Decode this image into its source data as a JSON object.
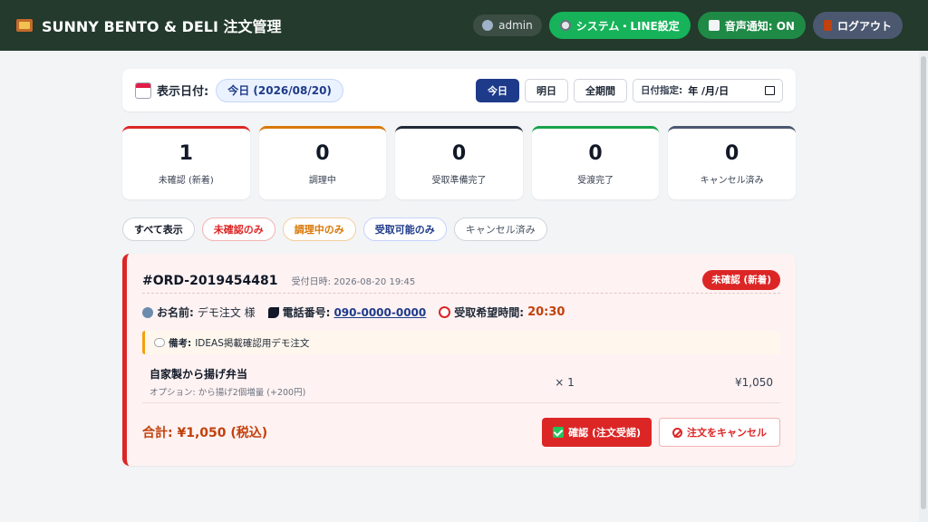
{
  "header": {
    "title": "SUNNY BENTO & DELI 注文管理",
    "user": "admin",
    "settings_label": "システム・LINE設定",
    "sound_label": "音声通知: ON",
    "logout_label": "ログアウト"
  },
  "date_bar": {
    "label": "表示日付:",
    "current": "今日 (2026/08/20)",
    "btn_today": "今日",
    "btn_tomorrow": "明日",
    "btn_all": "全期間",
    "picker_label": "日付指定:",
    "picker_value": "年 /月/日"
  },
  "stats": [
    {
      "count": "1",
      "label": "未確認 (新着)",
      "color": "#dc2626"
    },
    {
      "count": "0",
      "label": "調理中",
      "color": "#d97706"
    },
    {
      "count": "0",
      "label": "受取準備完了",
      "color": "#1f2937"
    },
    {
      "count": "0",
      "label": "受渡完了",
      "color": "#16a34a"
    },
    {
      "count": "0",
      "label": "キャンセル済み",
      "color": "#4b5870"
    }
  ],
  "filters": {
    "all": "すべて表示",
    "unconfirmed": "未確認のみ",
    "cooking": "調理中のみ",
    "ready": "受取可能のみ",
    "cancelled": "キャンセル済み"
  },
  "order": {
    "id": "#ORD-2019454481",
    "received": "受付日時: 2026-08-20 19:45",
    "status": "未確認 (新着)",
    "name_label": "お名前:",
    "name_value": "デモ注文 様",
    "phone_label": "電話番号:",
    "phone_value": "090-0000-0000",
    "pickup_label": "受取希望時間:",
    "pickup_value": "20:30",
    "note_label": "備考:",
    "note_value": "IDEAS掲載確認用デモ注文",
    "items": [
      {
        "name": "自家製から揚げ弁当",
        "option": "オプション: から揚げ2個増量 (+200円)",
        "qty": "× 1",
        "price": "¥1,050"
      }
    ],
    "total": "合計: ¥1,050 (税込)",
    "confirm_label": "確認 (注文受諾)",
    "cancel_label": "注文をキャンセル"
  }
}
